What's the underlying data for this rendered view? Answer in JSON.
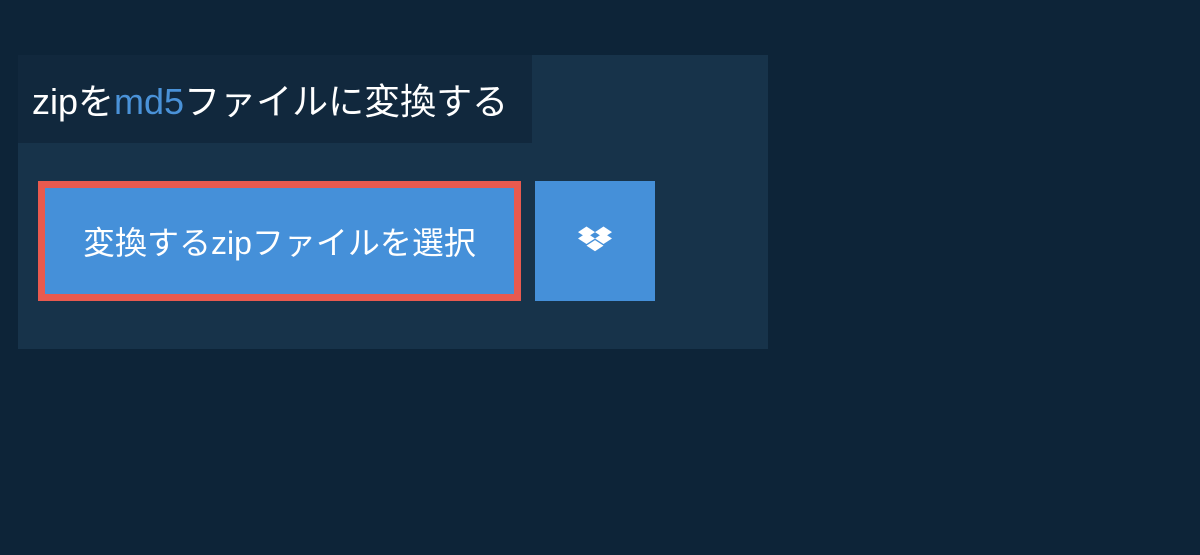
{
  "title": {
    "prefix": "zip",
    "middle": "を",
    "highlight": "md5",
    "suffix": "ファイルに変換する"
  },
  "buttons": {
    "select_label": "変換するzipファイルを選択"
  },
  "colors": {
    "background": "#0d2438",
    "panel": "#17334a",
    "title_bar": "#11283d",
    "button": "#4590d9",
    "highlight_border": "#e85a4f",
    "accent_text": "#4a92d8"
  }
}
